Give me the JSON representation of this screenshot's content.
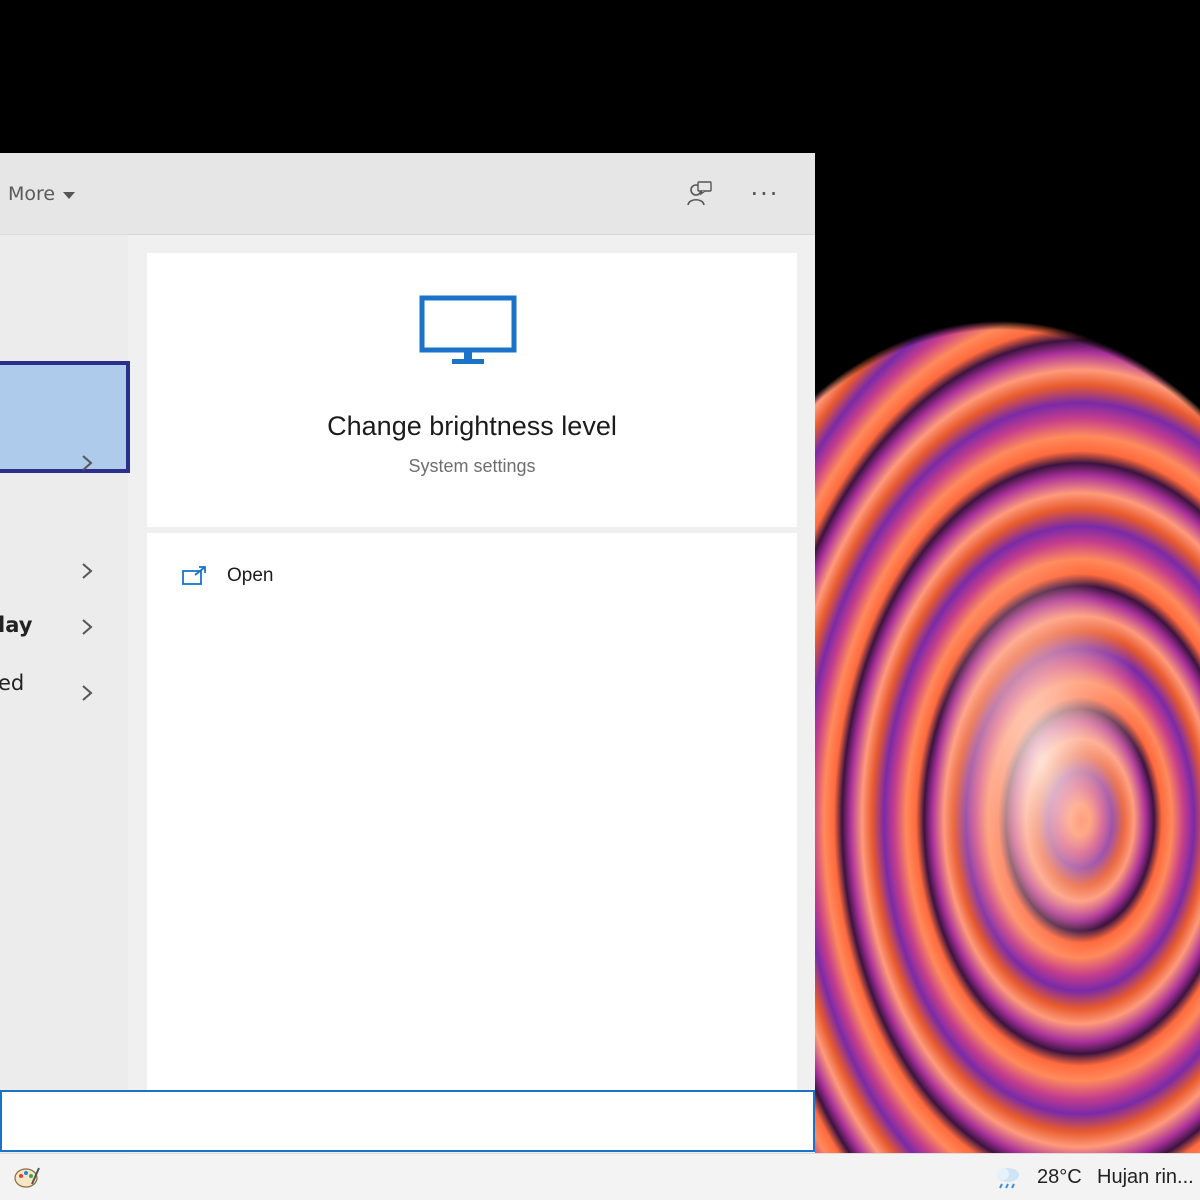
{
  "header": {
    "more_label": "More",
    "feedback_icon": "feedback-person-icon",
    "options_label": "···"
  },
  "left_list": {
    "items": [
      {
        "label": "",
        "selected": true
      },
      {
        "label": "",
        "has_chevron": true
      },
      {
        "label": "",
        "has_chevron": true
      },
      {
        "label": "lay",
        "has_chevron": true
      },
      {
        "label": "ed",
        "has_chevron": true
      }
    ]
  },
  "detail": {
    "icon": "monitor-icon",
    "title": "Change brightness level",
    "subtitle": "System settings",
    "accent_color": "#1a73c8"
  },
  "actions": {
    "open_label": "Open",
    "open_icon": "open-external-icon"
  },
  "search": {
    "value": ""
  },
  "taskbar": {
    "temperature": "28°C",
    "condition": "Hujan rin...",
    "weather_icon": "rain-cloud-icon"
  }
}
